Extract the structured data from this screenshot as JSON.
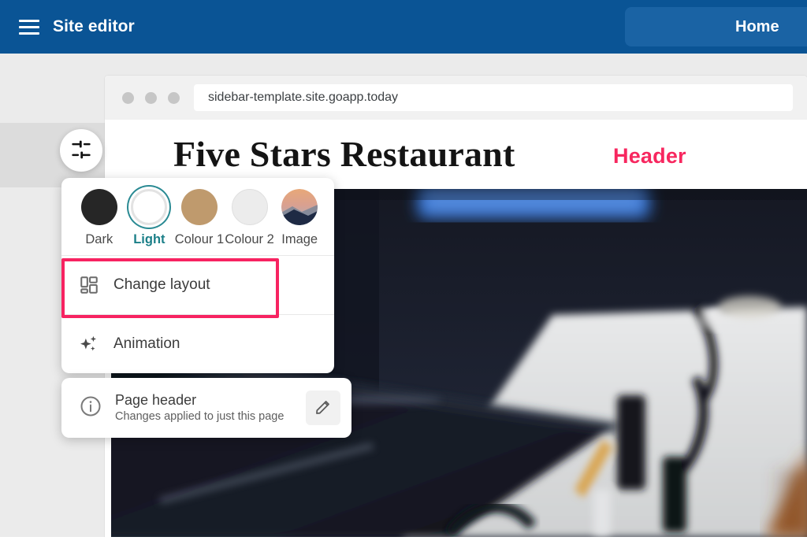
{
  "appbar": {
    "menu_icon": "hamburger-icon",
    "title": "Site editor",
    "home_label": "Home",
    "bg_color": "#0a5495",
    "button_color": "#1a63a4"
  },
  "browser": {
    "url": "sidebar-template.site.goapp.today",
    "traffic_lights": 3
  },
  "site": {
    "title": "Five Stars Restaurant",
    "annotation": {
      "label": "Header",
      "color": "#f7275f"
    },
    "hero_alt": "dark-restaurant-photo"
  },
  "tune_button": {
    "icon": "tune-sliders-icon"
  },
  "menu": {
    "swatches": [
      {
        "label": "Dark",
        "icon": "swatch-dark-circle",
        "color": "#262626",
        "selected": false
      },
      {
        "label": "Light",
        "icon": "swatch-light-circle",
        "color": "#ffffff",
        "selected": true
      },
      {
        "label": "Colour 1",
        "icon": "swatch-colour1-circle",
        "color": "#bf9a6d",
        "selected": false
      },
      {
        "label": "Colour 2",
        "icon": "swatch-colour2-circle",
        "color": "#ececec",
        "selected": false
      },
      {
        "label": "Image",
        "icon": "swatch-image-circle",
        "color": "#d8956b",
        "selected": false
      }
    ],
    "selected_accent": "#1b7f88",
    "items": [
      {
        "label": "Change layout",
        "icon": "grid-layout-icon",
        "highlighted": true,
        "highlight_color": "#f72361"
      },
      {
        "label": "Animation",
        "icon": "sparkles-icon",
        "highlighted": false,
        "highlight_color": ""
      }
    ]
  },
  "info_card": {
    "icon": "info-circle-icon",
    "title": "Page header",
    "subtitle": "Changes applied to just this page",
    "edit_icon": "pencil-edit-icon"
  }
}
